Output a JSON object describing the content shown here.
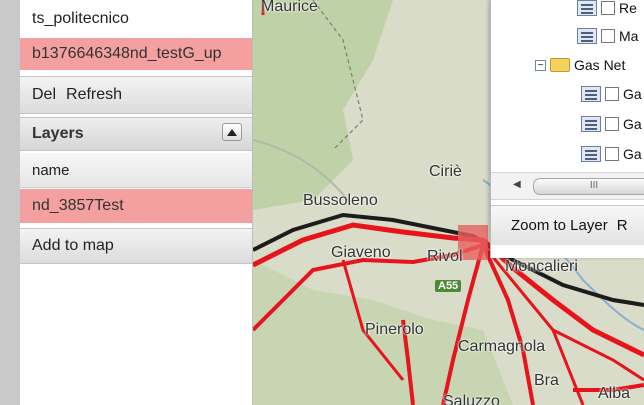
{
  "left_panel": {
    "top_rows": [
      "ts_politecnico",
      "b1376646348nd_testG_up"
    ],
    "toolbar": {
      "del": "Del",
      "refresh": "Refresh"
    },
    "layers": {
      "title": "Layers",
      "column_header": "name",
      "selected_row": "nd_3857Test",
      "add_to_map": "Add to map"
    }
  },
  "map": {
    "labels": [
      "Maurice",
      "Ciriè",
      "Bussoleno",
      "Giaveno",
      "Rivol",
      "Moncalieri",
      "Pinerolo",
      "Carmagnola",
      "Bra",
      "Alba",
      "Saluzzo"
    ],
    "shield": "A55",
    "colors": {
      "road": "#e8141c",
      "rail": "#1c1c1c"
    }
  },
  "layer_tree": {
    "items": [
      "Re",
      "Ma",
      "Gas Net",
      "Ga",
      "Ga",
      "Ga"
    ],
    "scroll_glyph": "III",
    "toolbar": {
      "zoom": "Zoom to Layer",
      "extra": "R"
    }
  }
}
